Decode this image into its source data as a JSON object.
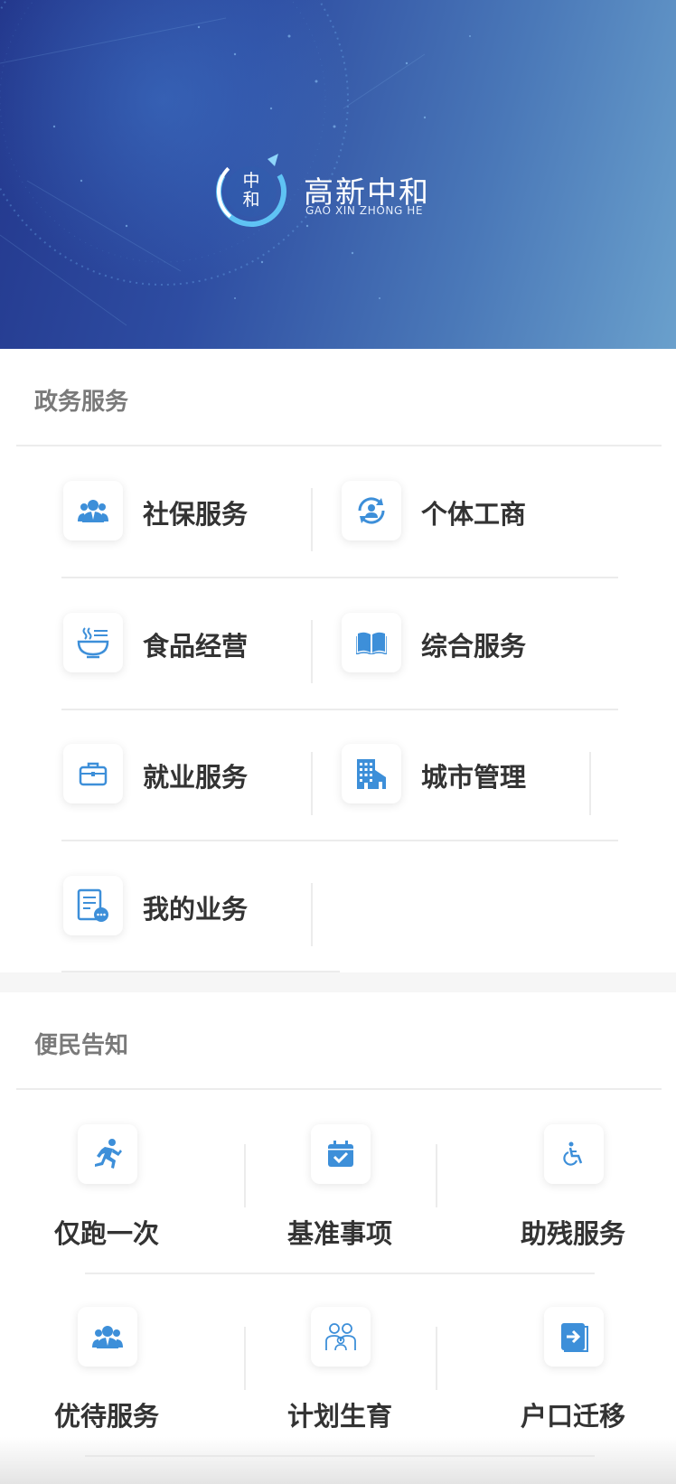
{
  "banner": {
    "logo_cn": "高新中和",
    "logo_en": "GAO XIN ZHONG HE",
    "emblem_text": "中和"
  },
  "gov_services": {
    "title": "政务服务",
    "items": [
      {
        "label": "社保服务",
        "icon": "users-icon"
      },
      {
        "label": "个体工商",
        "icon": "user-cycle-icon"
      },
      {
        "label": "食品经营",
        "icon": "bowl-icon"
      },
      {
        "label": "综合服务",
        "icon": "book-icon"
      },
      {
        "label": "就业服务",
        "icon": "briefcase-icon"
      },
      {
        "label": "城市管理",
        "icon": "building-icon"
      },
      {
        "label": "我的业务",
        "icon": "document-icon"
      }
    ]
  },
  "notices": {
    "title": "便民告知",
    "items": [
      {
        "label": "仅跑一次",
        "icon": "running-icon"
      },
      {
        "label": "基准事项",
        "icon": "calendar-check-icon"
      },
      {
        "label": "助残服务",
        "icon": "wheelchair-icon"
      },
      {
        "label": "优待服务",
        "icon": "users-icon"
      },
      {
        "label": "计划生育",
        "icon": "family-icon"
      },
      {
        "label": "户口迁移",
        "icon": "migrate-icon"
      }
    ]
  },
  "colors": {
    "accent": "#3d8fd9",
    "banner_start": "#23378c",
    "banner_end": "#6aa0cc",
    "label": "#333333",
    "section_title": "#7a7a7a"
  }
}
